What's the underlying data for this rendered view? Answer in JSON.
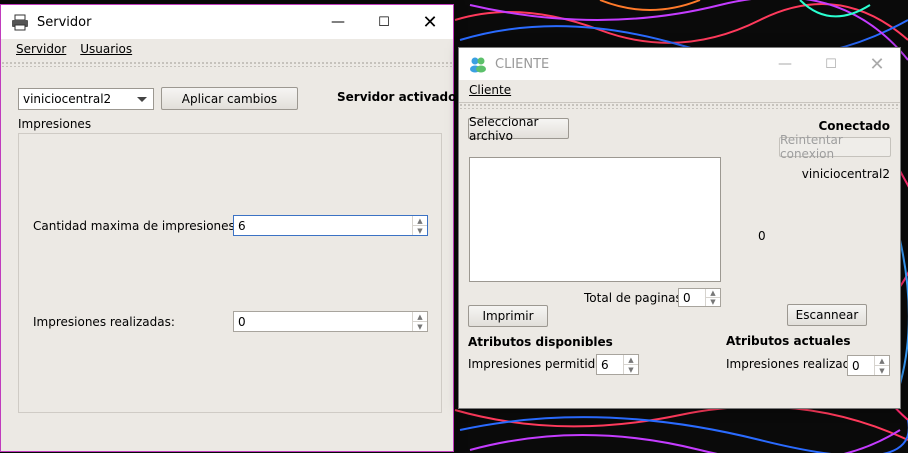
{
  "servidor": {
    "title": "Servidor",
    "menu": [
      "Servidor",
      "Usuarios"
    ],
    "user_select": "viniciocentral2",
    "apply_button": "Aplicar cambios",
    "status": "Servidor activado",
    "group_label": "Impresiones",
    "max_label": "Cantidad maxima de impresiones:",
    "max_value": "6",
    "done_label": "Impresiones realizadas:",
    "done_value": "0"
  },
  "cliente": {
    "title": "CLIENTE",
    "menu": [
      "Cliente"
    ],
    "select_file_button": "Seleccionar archivo",
    "status": "Conectado",
    "retry_button": "Reintentar conexion",
    "user": "viniciocentral2",
    "count_display": "0",
    "total_pages_label": "Total de paginas:",
    "total_pages_value": "0",
    "print_button": "Imprimir",
    "scan_button": "Escannear",
    "available_title": "Atributos disponibles",
    "allowed_label": "Impresiones permitidas:",
    "allowed_value": "6",
    "current_title": "Atributos actuales",
    "done_label": "Impresiones realizadas:",
    "done_value": "0"
  }
}
